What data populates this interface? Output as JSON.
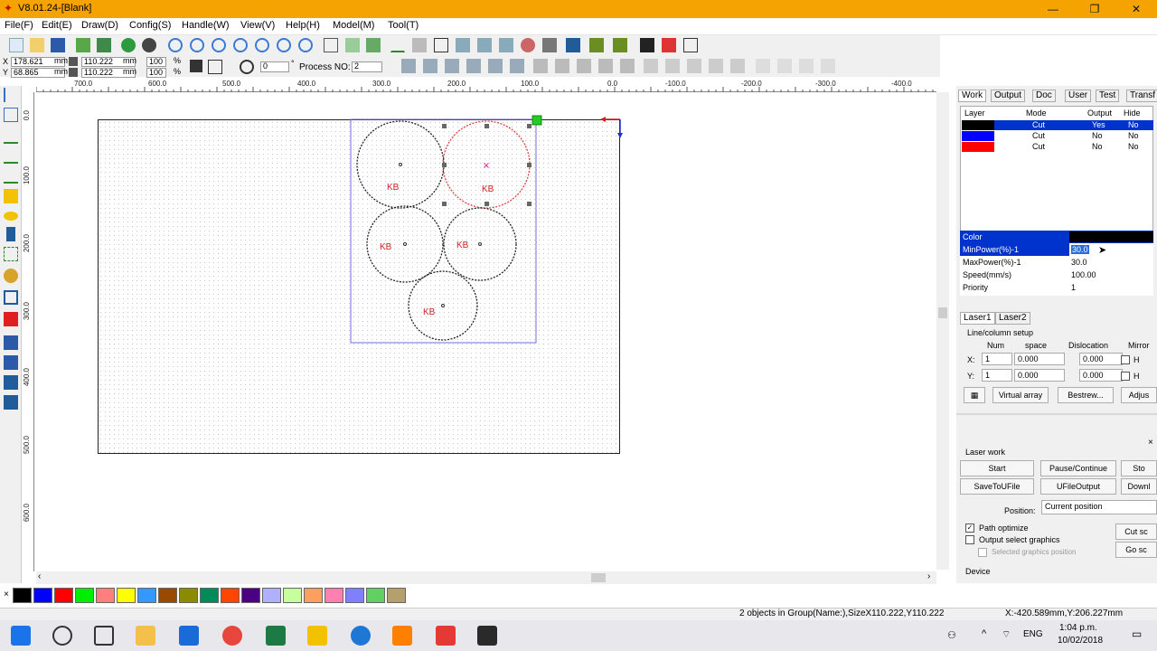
{
  "window": {
    "title": "V8.01.24-[Blank]",
    "minimize": "—",
    "maximize": "❐",
    "close": "✕"
  },
  "menu": [
    "File(F)",
    "Edit(E)",
    "Draw(D)",
    "Config(S)",
    "Handle(W)",
    "View(V)",
    "Help(H)",
    "Model(M)",
    "Tool(T)"
  ],
  "coords": {
    "x_label": "X",
    "y_label": "Y",
    "x_value": "178.621",
    "y_value": "68.865",
    "unit": "mm",
    "w_value": "110.222",
    "h_value": "110.222",
    "w_pct": "100",
    "h_pct": "100",
    "pct_unit": "%",
    "rotate": "0",
    "degree": "°",
    "process_label": "Process NO:",
    "process_value": "2"
  },
  "ruler": {
    "h_ticks": [
      "700.0",
      "600.0",
      "500.0",
      "400.0",
      "300.0",
      "200.0",
      "100.0",
      "0.0",
      "-100.0",
      "-200.0",
      "-300.0",
      "-400.0"
    ],
    "v_ticks": [
      "0.0",
      "100.0",
      "200.0",
      "300.0",
      "400.0",
      "500.0",
      "600.0"
    ]
  },
  "shapes": {
    "label": "KB"
  },
  "panel": {
    "tabs": [
      "Work",
      "Output",
      "Doc",
      "User",
      "Test",
      "Transf"
    ],
    "layer_headers": [
      "Layer",
      "Mode",
      "Output",
      "Hide"
    ],
    "layers": [
      {
        "color": "#000000",
        "mode": "Cut",
        "output": "Yes",
        "hide": "No"
      },
      {
        "color": "#0000ff",
        "mode": "Cut",
        "output": "No",
        "hide": "No"
      },
      {
        "color": "#ff0000",
        "mode": "Cut",
        "output": "No",
        "hide": "No"
      }
    ],
    "props": [
      {
        "key": "Color",
        "value": ""
      },
      {
        "key": "MinPower(%)-1",
        "value": "30.0"
      },
      {
        "key": "MaxPower(%)-1",
        "value": "30.0"
      },
      {
        "key": "Speed(mm/s)",
        "value": "100.00"
      },
      {
        "key": "Priority",
        "value": "1"
      }
    ],
    "laser_tabs": [
      "Laser1",
      "Laser2"
    ],
    "array_title": "Line/column setup",
    "array_headers": [
      "Num",
      "space",
      "Dislocation",
      "Mirror"
    ],
    "array_x": {
      "label": "X:",
      "num": "1",
      "space": "0.000",
      "dislocation": "0.000",
      "mirror": "H"
    },
    "array_y": {
      "label": "Y:",
      "num": "1",
      "space": "0.000",
      "dislocation": "0.000",
      "mirror": "H"
    },
    "virtual_array": "Virtual array",
    "bestrew": "Bestrew...",
    "adjust": "Adjus",
    "laser_work": "Laser work",
    "buttons": [
      "Start",
      "Pause/Continue",
      "Sto",
      "SaveToUFile",
      "UFileOutput",
      "Downl"
    ],
    "position_label": "Position:",
    "position_value": "Current position",
    "path_optimize": "Path optimize",
    "output_select": "Output select graphics",
    "selected_position": "Selected graphics position",
    "cut_sc": "Cut sc",
    "go_sc": "Go sc",
    "device": "Device"
  },
  "palette": [
    "#000000",
    "#0000ff",
    "#ff0000",
    "#00ee00",
    "#ff7f7f",
    "#ffff00",
    "#3399ff",
    "#9a4a00",
    "#8b8b00",
    "#008b5b",
    "#ff4500",
    "#4b0082",
    "#b0b0ff",
    "#c7ff9c",
    "#ff9f5f",
    "#ff7fb0",
    "#8080ff",
    "#60d060",
    "#b4a06c"
  ],
  "status": {
    "message": "2 objects in Group(Name:),SizeX110.222,Y110.222",
    "cursor": "X:-420.589mm,Y:206.227mm"
  },
  "taskbar": {
    "lang": "ENG",
    "time": "1:04 p.m.",
    "date": "10/02/2018"
  }
}
